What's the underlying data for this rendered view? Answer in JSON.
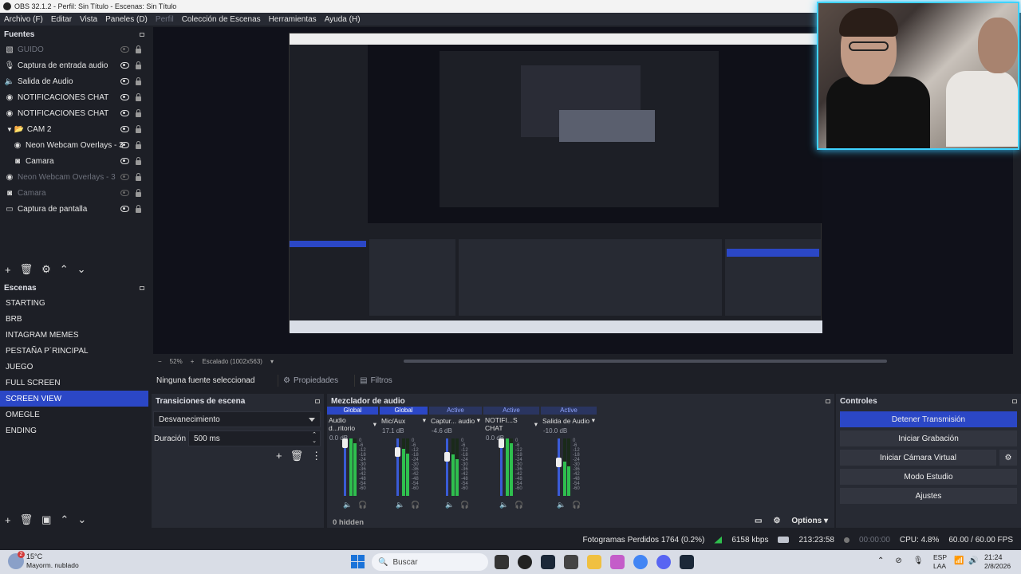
{
  "window": {
    "title": "OBS 32.1.2 - Perfil: Sin Título - Escenas: Sin Título"
  },
  "menu": [
    "Archivo (F)",
    "Editar",
    "Vista",
    "Paneles (D)",
    "Perfil",
    "Colección de Escenas",
    "Herramientas",
    "Ayuda (H)"
  ],
  "sources": {
    "title": "Fuentes",
    "items": [
      {
        "label": "GUIDO",
        "icon": "image-icon",
        "visible": false
      },
      {
        "label": "Captura de entrada audio",
        "icon": "mic-icon",
        "visible": true
      },
      {
        "label": "Salida de Audio",
        "icon": "speaker-icon",
        "visible": true
      },
      {
        "label": "NOTIFICACIONES CHAT",
        "icon": "browser-icon",
        "visible": true
      },
      {
        "label": "NOTIFICACIONES CHAT",
        "icon": "browser-icon",
        "visible": true
      },
      {
        "label": "CAM 2",
        "icon": "folder-icon",
        "visible": true
      },
      {
        "label": "Neon Webcam Overlays - 3",
        "icon": "browser-icon",
        "visible": true
      },
      {
        "label": "Camara",
        "icon": "camera-icon",
        "visible": true
      },
      {
        "label": "Neon Webcam Overlays - 3",
        "icon": "browser-icon",
        "visible": false
      },
      {
        "label": "Camara",
        "icon": "camera-icon",
        "visible": false
      },
      {
        "label": "Captura de pantalla",
        "icon": "monitor-icon",
        "visible": true
      }
    ]
  },
  "scenes": {
    "title": "Escenas",
    "items": [
      "STARTING",
      "BRB",
      "INTAGRAM MEMES",
      "PESTAÑA P´RINCIPAL",
      "JUEGO",
      "FULL SCREEN",
      "SCREEN VIEW",
      "OMEGLE",
      "ENDING"
    ],
    "selected": "SCREEN VIEW"
  },
  "preview": {
    "zoom": "52%",
    "scale_label": "Escalado (1002x563)"
  },
  "source_bar": {
    "none_selected": "Ninguna fuente seleccionad",
    "properties": "Propiedades",
    "filters": "Filtros"
  },
  "transitions": {
    "title": "Transiciones de escena",
    "current": "Desvanecimiento",
    "duration_label": "Duración",
    "duration_value": "500 ms"
  },
  "mixer": {
    "title": "Mezclador de audio",
    "hidden_label": "0 hidden",
    "channels": [
      {
        "badge": "Global",
        "name": "Audio d...ritorio",
        "db": "0.0 dB",
        "level": 1.0,
        "muted": false
      },
      {
        "badge": "Global",
        "name": "Mic/Aux",
        "db": "17.1 dB",
        "level": 0.82,
        "muted": false
      },
      {
        "badge": "Active",
        "name": "Captur... audio",
        "db": "-4.6 dB",
        "level": 0.72,
        "muted": true
      },
      {
        "badge": "Active",
        "name": "NOTIFI...S CHAT",
        "db": "0.0 dB",
        "level": 1.0,
        "muted": false
      },
      {
        "badge": "Active",
        "name": "Salida de Audio",
        "db": "-10.0 dB",
        "level": 0.6,
        "muted": false
      }
    ],
    "scale": [
      "0",
      "-6",
      "-12",
      "-18",
      "-24",
      "-30",
      "-36",
      "-42",
      "-48",
      "-54",
      "-60"
    ]
  },
  "controls": {
    "title": "Controles",
    "stop_stream": "Detener Transmisión",
    "start_record": "Iniciar Grabación",
    "start_virtual_cam": "Iniciar Cámara Virtual",
    "studio_mode": "Modo Estudio",
    "settings": "Ajustes",
    "options": "Options"
  },
  "status": {
    "dropped_frames": "Fotogramas Perdidos 1764 (0.2%)",
    "bitrate": "6158 kbps",
    "stream_time": "213:23:58",
    "record_time": "00:00:00",
    "cpu": "CPU: 4.8%",
    "fps": "60.00 / 60.00 FPS"
  },
  "taskbar": {
    "weather_temp": "15°C",
    "weather_desc": "Mayorm. nublado",
    "weather_badge": "2",
    "search_placeholder": "Buscar",
    "lang": "ESP",
    "lang2": "LAA",
    "time": "21:24",
    "date": "2/8/2026"
  },
  "colors": {
    "accent": "#2b47c6",
    "bg": "#1d1f26",
    "panel": "#272a33",
    "webcam_glow": "#3fd3ff"
  }
}
